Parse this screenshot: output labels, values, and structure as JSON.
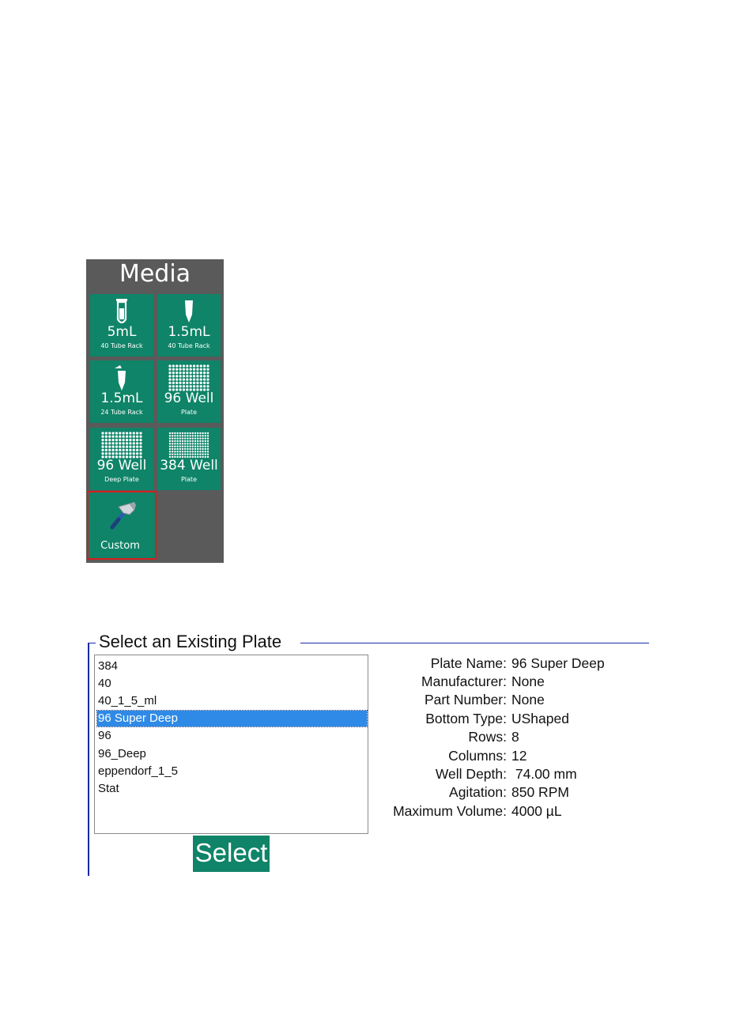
{
  "media": {
    "title": "Media",
    "tiles": [
      {
        "main": "5mL",
        "sub": "40 Tube Rack",
        "icon": "tube-icon"
      },
      {
        "main": "1.5mL",
        "sub": "40 Tube Rack",
        "icon": "microtube-icon"
      },
      {
        "main": "1.5mL",
        "sub": "24 Tube Rack",
        "icon": "open-microtube-icon"
      },
      {
        "main": "96 Well",
        "sub": "Plate",
        "icon": "well-plate-icon"
      },
      {
        "main": "96 Well",
        "sub": "Deep Plate",
        "icon": "well-plate-icon"
      },
      {
        "main": "384 Well",
        "sub": "Plate",
        "icon": "well-plate-icon"
      },
      {
        "main": "Custom",
        "sub": "",
        "icon": "hammer-icon"
      }
    ],
    "selected_tile": "Custom",
    "colors": {
      "panel": "#5a5a5a",
      "tile": "#0f8468",
      "selected_border": "#d61f1f"
    }
  },
  "select_plate": {
    "title": "Select an Existing Plate",
    "items": [
      "384",
      "40",
      "40_1_5_ml",
      "96 Super Deep",
      "96",
      "96_Deep",
      "eppendorf_1_5",
      "Stat"
    ],
    "selected_item": "96 Super Deep",
    "button_label": "Select",
    "details": [
      {
        "label": "Plate Name:",
        "value": "96 Super Deep"
      },
      {
        "label": "Manufacturer:",
        "value": "None"
      },
      {
        "label": "Part Number:",
        "value": "None"
      },
      {
        "label": "Bottom Type:",
        "value": "UShaped"
      },
      {
        "label": "Rows:",
        "value": "8"
      },
      {
        "label": "Columns:",
        "value": "12"
      },
      {
        "label": "Well Depth:",
        "value": " 74.00 mm"
      },
      {
        "label": "Agitation:",
        "value": "850 RPM"
      },
      {
        "label": "Maximum Volume:",
        "value": "4000 µL"
      }
    ],
    "colors": {
      "group_border": "#1a2aa8",
      "selection": "#2e8ae6",
      "button": "#0f8468"
    }
  }
}
